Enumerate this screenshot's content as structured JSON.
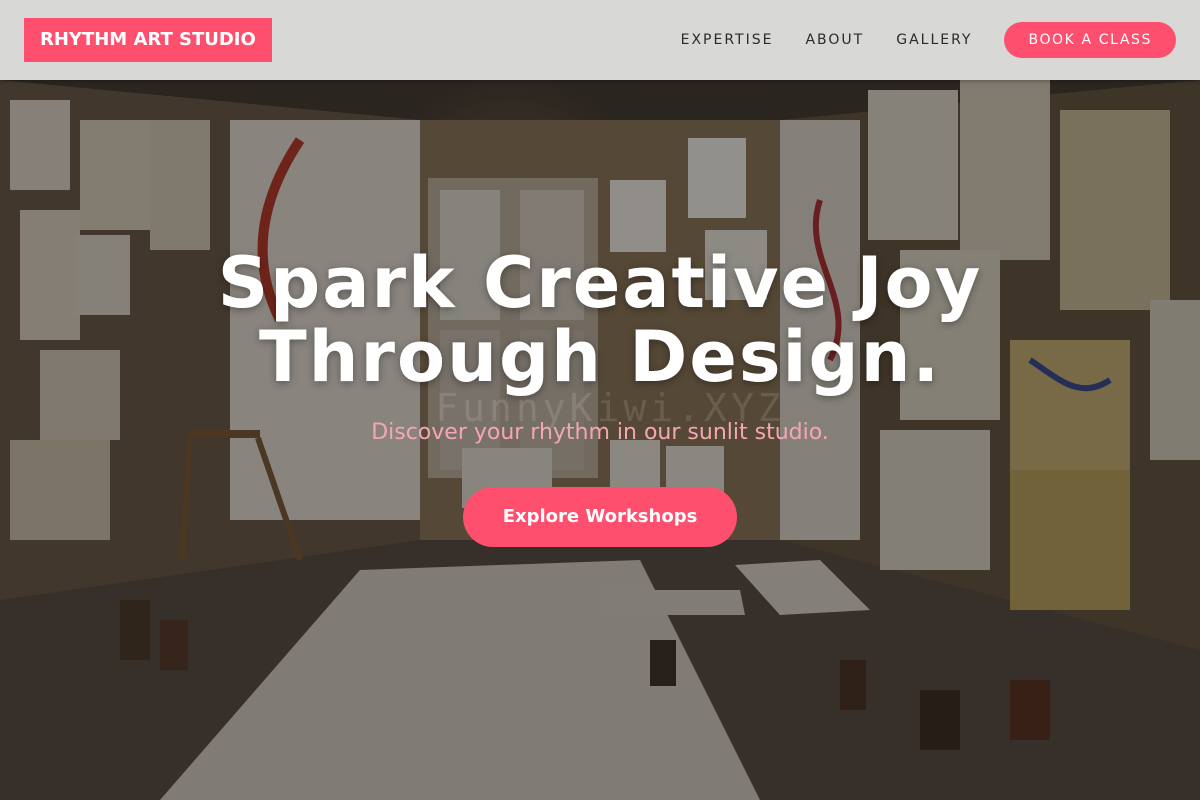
{
  "header": {
    "logo": "RHYTHM ART STUDIO",
    "nav": [
      "EXPERTISE",
      "ABOUT",
      "GALLERY"
    ],
    "cta_label": "BOOK A CLASS"
  },
  "hero": {
    "title_line1": "Spark Creative Joy",
    "title_line2": "Through Design.",
    "subtitle": "Discover your rhythm in our sunlit studio.",
    "cta_label": "Explore Workshops",
    "watermark": "FunnyKiwi.XYZ"
  },
  "colors": {
    "accent": "#ff4f6e",
    "subtitle": "#f6a6b2",
    "header_bg": "#e1e1e1"
  }
}
